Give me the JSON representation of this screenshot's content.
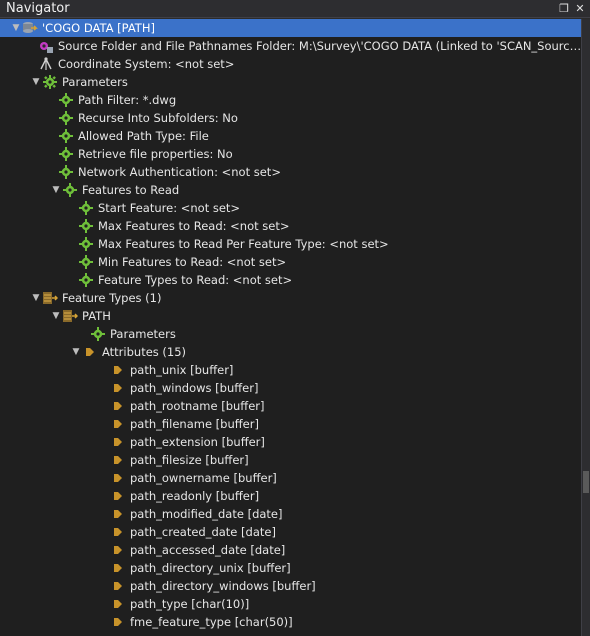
{
  "window": {
    "title": "Navigator",
    "restore_glyph": "❐",
    "close_glyph": "✕"
  },
  "tree": {
    "root": {
      "label": "'COGO DATA [PATH]",
      "icon": "database-icon"
    },
    "source_folder": {
      "label": "Source Folder and File Pathnames Folder: M:\\Survey\\'COGO DATA (Linked to 'SCAN_SourceD...",
      "icon": "source-folder-icon"
    },
    "coordinate_system": {
      "label": "Coordinate System: <not set>",
      "icon": "coordinate-system-icon"
    },
    "parameters": {
      "label": "Parameters",
      "items": [
        "Path Filter: *.dwg",
        "Recurse Into Subfolders: No",
        "Allowed Path Type: File",
        "Retrieve file properties: No",
        "Network Authentication: <not set>"
      ],
      "features_to_read": {
        "label": "Features to Read",
        "items": [
          "Start Feature: <not set>",
          "Max Features to Read: <not set>",
          "Max Features to Read Per Feature Type: <not set>",
          "Min Features to Read: <not set>",
          "Feature Types to Read: <not set>"
        ]
      }
    },
    "feature_types": {
      "label": "Feature Types (1)",
      "path": {
        "label": "PATH",
        "parameters_label": "Parameters",
        "attributes": {
          "label": "Attributes (15)",
          "items": [
            "path_unix [buffer]",
            "path_windows [buffer]",
            "path_rootname [buffer]",
            "path_filename [buffer]",
            "path_extension [buffer]",
            "path_filesize [buffer]",
            "path_ownername [buffer]",
            "path_readonly [buffer]",
            "path_modified_date [date]",
            "path_created_date [date]",
            "path_accessed_date [date]",
            "path_directory_unix [buffer]",
            "path_directory_windows [buffer]",
            "path_type [char(10)]",
            "fme_feature_type [char(50)]"
          ]
        }
      }
    }
  },
  "colors": {
    "selected_row": "#3b72c9",
    "gear_green": "#6fbf3a",
    "attribute_arrow": "#c8932a",
    "background": "#1f1f1f"
  }
}
